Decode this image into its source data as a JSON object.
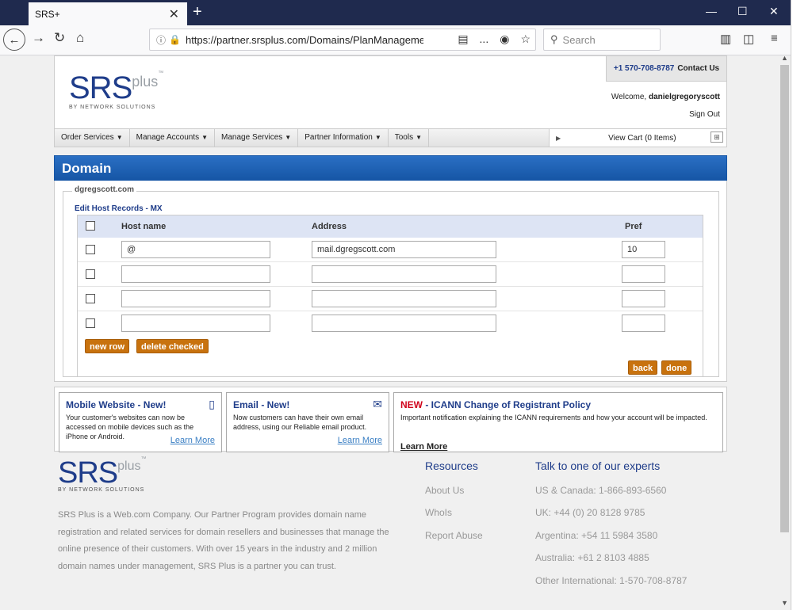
{
  "browser": {
    "tab_title": "SRS+",
    "url_main": "https://partner.srsplus.com/Domains/PlanManagement",
    "url_faded": "...",
    "search_placeholder": "Search"
  },
  "header": {
    "logo_main": "SRS",
    "logo_plus": "plus",
    "logo_tm": "™",
    "logo_sub": "BY NETWORK SOLUTIONS",
    "phone": "+1 570-708-8787",
    "contact": "Contact Us",
    "welcome_prefix": "Welcome,",
    "username": "danielgregoryscott",
    "sign_out": "Sign Out"
  },
  "menu": {
    "items": [
      {
        "label": "Order Services"
      },
      {
        "label": "Manage Accounts"
      },
      {
        "label": "Manage Services"
      },
      {
        "label": "Partner Information"
      },
      {
        "label": "Tools"
      }
    ],
    "cart": "View Cart (0 Items)"
  },
  "domain": {
    "title": "Domain",
    "name": "dgregscott.com",
    "section": "Edit Host Records - MX",
    "columns": {
      "host": "Host name",
      "address": "Address",
      "pref": "Pref"
    },
    "rows": [
      {
        "host": "@",
        "address": "mail.dgregscott.com",
        "pref": "10"
      },
      {
        "host": "",
        "address": "",
        "pref": ""
      },
      {
        "host": "",
        "address": "",
        "pref": ""
      },
      {
        "host": "",
        "address": "",
        "pref": ""
      }
    ],
    "buttons": {
      "new_row": "new row",
      "delete_checked": "delete checked",
      "back": "back",
      "done": "done"
    }
  },
  "promos": [
    {
      "title": "Mobile Website - New!",
      "text": "Your customer's websites can now be accessed on mobile devices such as the iPhone or Android.",
      "link": "Learn More"
    },
    {
      "title": "Email - New!",
      "text": "Now customers can have their own email address, using our Reliable email product.",
      "link": "Learn More"
    },
    {
      "title_new": "NEW",
      "title": " - ICANN Change of Registrant Policy",
      "text": "Important notification explaining the ICANN requirements and how your account will be impacted.",
      "link": "Learn More"
    }
  ],
  "footer": {
    "about": "SRS Plus is a Web.com Company. Our Partner Program provides domain name registration and related services for domain resellers and businesses that manage the online presence of their customers. With over 15 years in the industry and 2 million domain names under management, SRS Plus is a partner you can trust.",
    "resources_heading": "Resources",
    "resources": [
      "About Us",
      "WhoIs",
      "Report Abuse"
    ],
    "experts_heading": "Talk to one of our experts",
    "experts": [
      "US & Canada: 1-866-893-6560",
      "UK: +44 (0) 20 8128 9785",
      "Argentina: +54 11 5984 3580",
      "Australia: +61 2 8103 4885",
      "Other International: 1-570-708-8787"
    ]
  }
}
